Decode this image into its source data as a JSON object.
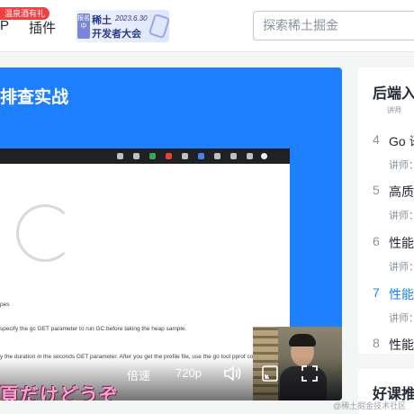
{
  "nav": {
    "hot_badge": "温泉酒有礼",
    "partial_item": "P",
    "plugin_label": "插件",
    "conference": {
      "tag": "报名中",
      "line1": "稀土",
      "date": "2023.6.30",
      "line2": "开发者大会"
    },
    "search_placeholder": "探索稀土掘金"
  },
  "player": {
    "title": "排查实战",
    "doc_lines": [
      "pes",
      "specify the gc GET parameter to run GC before taking the heap sample.",
      "y the duration in the seconds GET parameter. After you get the profile file, use the go tool pprof command to investigate the profile."
    ],
    "speed_label": "倍速",
    "quality_label": "720p",
    "subtitle": "頁だけどうぞ",
    "icons": [
      "volume-icon",
      "picture-in-picture-icon",
      "fullscreen-icon"
    ]
  },
  "sidebar": {
    "title": "后端入",
    "peek_text": "讲师",
    "lessons": [
      {
        "num": "4",
        "name": "Go 语",
        "teacher": "讲师：",
        "active": false
      },
      {
        "num": "5",
        "name": "高质量",
        "teacher": "讲师：",
        "active": false
      },
      {
        "num": "6",
        "name": "性能优",
        "teacher": "讲师：",
        "active": false
      },
      {
        "num": "7",
        "name": "性能优",
        "teacher": "讲师：",
        "active": true
      },
      {
        "num": "8",
        "name": "性能调",
        "teacher": "",
        "active": false
      }
    ],
    "recommend_title": "好课推"
  },
  "watermark": "@稀土掘金技术社区",
  "colors": {
    "accent": "#1e80ff",
    "badge_red": "#f53f3f",
    "subtitle_pink": "#f5a6d0"
  }
}
